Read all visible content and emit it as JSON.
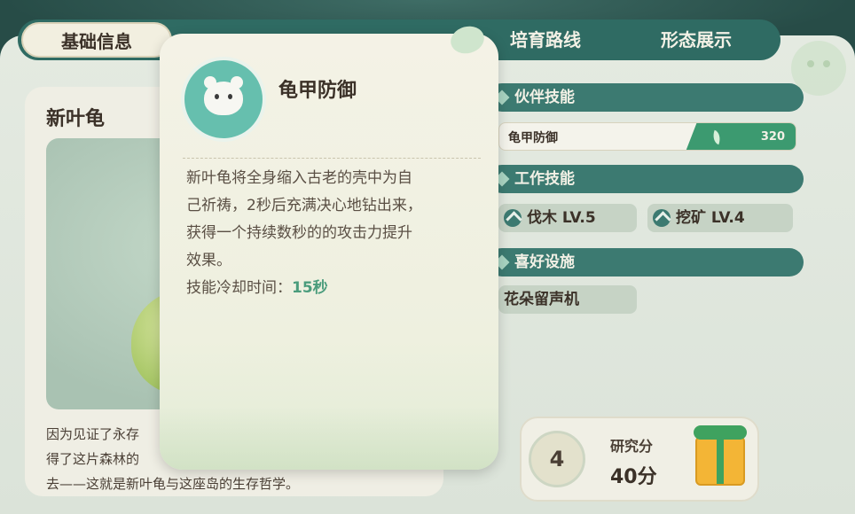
{
  "tabs": [
    {
      "label": "基础信息",
      "active": true
    },
    {
      "label": "培育路线",
      "active": false
    },
    {
      "label": "形态展示",
      "active": false
    }
  ],
  "creature": {
    "name": "新叶龟",
    "desc_lines": [
      "因为见证了永存",
      "得了这片森林的",
      "去——这就是新叶龟与这座岛的生存哲学。"
    ]
  },
  "partner_skill_section": {
    "title": "伙伴技能",
    "skill_name": "龟甲防御",
    "skill_value": "320"
  },
  "work_skill_section": {
    "title": "工作技能",
    "skills": [
      {
        "label": "伐木 LV.5",
        "icon": "axe-icon"
      },
      {
        "label": "挖矿 LV.4",
        "icon": "pickaxe-icon"
      }
    ]
  },
  "facility_section": {
    "title": "喜好设施",
    "facility": "花朵留声机"
  },
  "research": {
    "level": "4",
    "label": "研究分",
    "value": "40分"
  },
  "tooltip": {
    "title": "龟甲防御",
    "desc_lines": [
      "新叶龟将全身缩入古老的壳中为自",
      "己祈祷，2秒后充满决心地钻出来，",
      "获得一个持续数秒的的攻击力提升",
      "效果。"
    ],
    "cooldown_label": "技能冷却时间：",
    "cooldown_value": "15秒",
    "icon": "bear-skill-icon"
  },
  "colors": {
    "tab_bar": "#2f6b63",
    "section_bar": "#3c7a71",
    "accent_green": "#3c9a70",
    "cooldown_text": "#4a9c7c"
  }
}
